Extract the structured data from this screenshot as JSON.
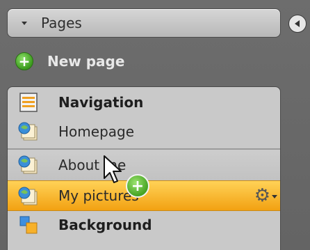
{
  "panel": {
    "title": "Pages"
  },
  "actions": {
    "new_page_label": "New page"
  },
  "pages": [
    {
      "label": "Navigation",
      "bold": true,
      "icon": "navigation-icon"
    },
    {
      "label": "Homepage",
      "bold": false,
      "icon": "page-icon"
    },
    {
      "label": "About me",
      "bold": false,
      "icon": "page-icon"
    },
    {
      "label": "My pictures",
      "bold": false,
      "icon": "page-icon",
      "selected": true
    },
    {
      "label": "Background",
      "bold": true,
      "icon": "background-icon"
    }
  ],
  "colors": {
    "selected_row": "#f7b52c",
    "add_icon": "#43a11f"
  }
}
